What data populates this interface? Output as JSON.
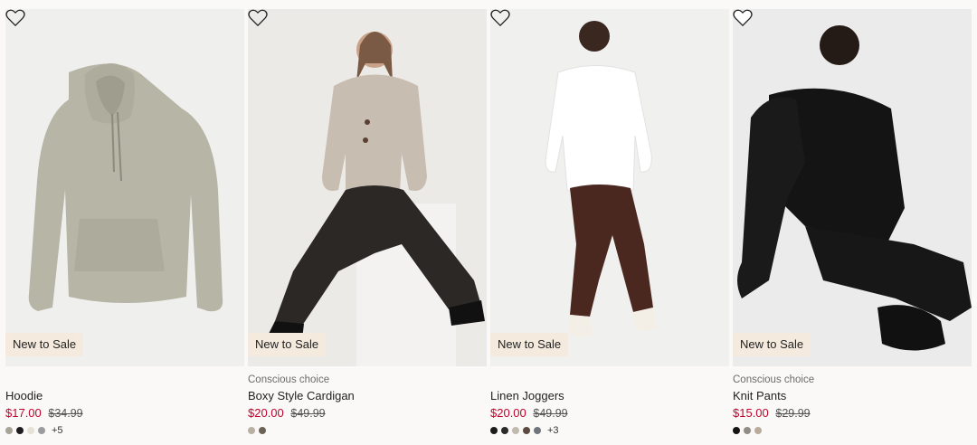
{
  "products": [
    {
      "badge": "New to Sale",
      "tag": "",
      "name": "Hoodie",
      "sale_price": "$17.00",
      "original_price": "$34.99",
      "swatch_colors": [
        "#a7a497",
        "#1d1d1d",
        "#e6e1d6",
        "#9a9c9d"
      ],
      "more_colors": "+5",
      "favorite_icon": "heart-outline-icon"
    },
    {
      "badge": "New to Sale",
      "tag": "Conscious choice",
      "name": "Boxy Style Cardigan",
      "sale_price": "$20.00",
      "original_price": "$49.99",
      "swatch_colors": [
        "#b8b0a3",
        "#6a6355"
      ],
      "more_colors": "",
      "favorite_icon": "heart-outline-icon"
    },
    {
      "badge": "New to Sale",
      "tag": "",
      "name": "Linen Joggers",
      "sale_price": "$20.00",
      "original_price": "$49.99",
      "swatch_colors": [
        "#1b1b1b",
        "#2a2a2a",
        "#bfb9ae",
        "#5a4a40",
        "#70757b"
      ],
      "more_colors": "+3",
      "favorite_icon": "heart-outline-icon"
    },
    {
      "badge": "New to Sale",
      "tag": "Conscious choice",
      "name": "Knit Pants",
      "sale_price": "$15.00",
      "original_price": "$29.99",
      "swatch_colors": [
        "#141414",
        "#8f8c86",
        "#b9aa99"
      ],
      "more_colors": "",
      "favorite_icon": "heart-outline-icon"
    }
  ],
  "colors": {
    "sale_price": "#c0042c",
    "badge_background": "#f4ebde",
    "page_background": "#faf9f8"
  }
}
